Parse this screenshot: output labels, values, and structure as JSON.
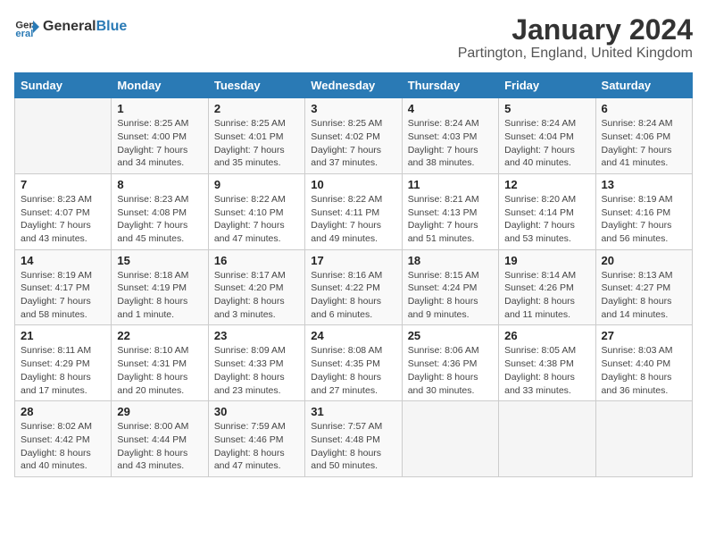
{
  "logo": {
    "text_general": "General",
    "text_blue": "Blue",
    "icon_symbol": "▶"
  },
  "title": "January 2024",
  "subtitle": "Partington, England, United Kingdom",
  "days": [
    "Sunday",
    "Monday",
    "Tuesday",
    "Wednesday",
    "Thursday",
    "Friday",
    "Saturday"
  ],
  "weeks": [
    [
      {
        "day": "",
        "sunrise": "",
        "sunset": "",
        "daylight": ""
      },
      {
        "day": "1",
        "sunrise": "Sunrise: 8:25 AM",
        "sunset": "Sunset: 4:00 PM",
        "daylight": "Daylight: 7 hours and 34 minutes."
      },
      {
        "day": "2",
        "sunrise": "Sunrise: 8:25 AM",
        "sunset": "Sunset: 4:01 PM",
        "daylight": "Daylight: 7 hours and 35 minutes."
      },
      {
        "day": "3",
        "sunrise": "Sunrise: 8:25 AM",
        "sunset": "Sunset: 4:02 PM",
        "daylight": "Daylight: 7 hours and 37 minutes."
      },
      {
        "day": "4",
        "sunrise": "Sunrise: 8:24 AM",
        "sunset": "Sunset: 4:03 PM",
        "daylight": "Daylight: 7 hours and 38 minutes."
      },
      {
        "day": "5",
        "sunrise": "Sunrise: 8:24 AM",
        "sunset": "Sunset: 4:04 PM",
        "daylight": "Daylight: 7 hours and 40 minutes."
      },
      {
        "day": "6",
        "sunrise": "Sunrise: 8:24 AM",
        "sunset": "Sunset: 4:06 PM",
        "daylight": "Daylight: 7 hours and 41 minutes."
      }
    ],
    [
      {
        "day": "7",
        "sunrise": "Sunrise: 8:23 AM",
        "sunset": "Sunset: 4:07 PM",
        "daylight": "Daylight: 7 hours and 43 minutes."
      },
      {
        "day": "8",
        "sunrise": "Sunrise: 8:23 AM",
        "sunset": "Sunset: 4:08 PM",
        "daylight": "Daylight: 7 hours and 45 minutes."
      },
      {
        "day": "9",
        "sunrise": "Sunrise: 8:22 AM",
        "sunset": "Sunset: 4:10 PM",
        "daylight": "Daylight: 7 hours and 47 minutes."
      },
      {
        "day": "10",
        "sunrise": "Sunrise: 8:22 AM",
        "sunset": "Sunset: 4:11 PM",
        "daylight": "Daylight: 7 hours and 49 minutes."
      },
      {
        "day": "11",
        "sunrise": "Sunrise: 8:21 AM",
        "sunset": "Sunset: 4:13 PM",
        "daylight": "Daylight: 7 hours and 51 minutes."
      },
      {
        "day": "12",
        "sunrise": "Sunrise: 8:20 AM",
        "sunset": "Sunset: 4:14 PM",
        "daylight": "Daylight: 7 hours and 53 minutes."
      },
      {
        "day": "13",
        "sunrise": "Sunrise: 8:19 AM",
        "sunset": "Sunset: 4:16 PM",
        "daylight": "Daylight: 7 hours and 56 minutes."
      }
    ],
    [
      {
        "day": "14",
        "sunrise": "Sunrise: 8:19 AM",
        "sunset": "Sunset: 4:17 PM",
        "daylight": "Daylight: 7 hours and 58 minutes."
      },
      {
        "day": "15",
        "sunrise": "Sunrise: 8:18 AM",
        "sunset": "Sunset: 4:19 PM",
        "daylight": "Daylight: 8 hours and 1 minute."
      },
      {
        "day": "16",
        "sunrise": "Sunrise: 8:17 AM",
        "sunset": "Sunset: 4:20 PM",
        "daylight": "Daylight: 8 hours and 3 minutes."
      },
      {
        "day": "17",
        "sunrise": "Sunrise: 8:16 AM",
        "sunset": "Sunset: 4:22 PM",
        "daylight": "Daylight: 8 hours and 6 minutes."
      },
      {
        "day": "18",
        "sunrise": "Sunrise: 8:15 AM",
        "sunset": "Sunset: 4:24 PM",
        "daylight": "Daylight: 8 hours and 9 minutes."
      },
      {
        "day": "19",
        "sunrise": "Sunrise: 8:14 AM",
        "sunset": "Sunset: 4:26 PM",
        "daylight": "Daylight: 8 hours and 11 minutes."
      },
      {
        "day": "20",
        "sunrise": "Sunrise: 8:13 AM",
        "sunset": "Sunset: 4:27 PM",
        "daylight": "Daylight: 8 hours and 14 minutes."
      }
    ],
    [
      {
        "day": "21",
        "sunrise": "Sunrise: 8:11 AM",
        "sunset": "Sunset: 4:29 PM",
        "daylight": "Daylight: 8 hours and 17 minutes."
      },
      {
        "day": "22",
        "sunrise": "Sunrise: 8:10 AM",
        "sunset": "Sunset: 4:31 PM",
        "daylight": "Daylight: 8 hours and 20 minutes."
      },
      {
        "day": "23",
        "sunrise": "Sunrise: 8:09 AM",
        "sunset": "Sunset: 4:33 PM",
        "daylight": "Daylight: 8 hours and 23 minutes."
      },
      {
        "day": "24",
        "sunrise": "Sunrise: 8:08 AM",
        "sunset": "Sunset: 4:35 PM",
        "daylight": "Daylight: 8 hours and 27 minutes."
      },
      {
        "day": "25",
        "sunrise": "Sunrise: 8:06 AM",
        "sunset": "Sunset: 4:36 PM",
        "daylight": "Daylight: 8 hours and 30 minutes."
      },
      {
        "day": "26",
        "sunrise": "Sunrise: 8:05 AM",
        "sunset": "Sunset: 4:38 PM",
        "daylight": "Daylight: 8 hours and 33 minutes."
      },
      {
        "day": "27",
        "sunrise": "Sunrise: 8:03 AM",
        "sunset": "Sunset: 4:40 PM",
        "daylight": "Daylight: 8 hours and 36 minutes."
      }
    ],
    [
      {
        "day": "28",
        "sunrise": "Sunrise: 8:02 AM",
        "sunset": "Sunset: 4:42 PM",
        "daylight": "Daylight: 8 hours and 40 minutes."
      },
      {
        "day": "29",
        "sunrise": "Sunrise: 8:00 AM",
        "sunset": "Sunset: 4:44 PM",
        "daylight": "Daylight: 8 hours and 43 minutes."
      },
      {
        "day": "30",
        "sunrise": "Sunrise: 7:59 AM",
        "sunset": "Sunset: 4:46 PM",
        "daylight": "Daylight: 8 hours and 47 minutes."
      },
      {
        "day": "31",
        "sunrise": "Sunrise: 7:57 AM",
        "sunset": "Sunset: 4:48 PM",
        "daylight": "Daylight: 8 hours and 50 minutes."
      },
      {
        "day": "",
        "sunrise": "",
        "sunset": "",
        "daylight": ""
      },
      {
        "day": "",
        "sunrise": "",
        "sunset": "",
        "daylight": ""
      },
      {
        "day": "",
        "sunrise": "",
        "sunset": "",
        "daylight": ""
      }
    ]
  ]
}
